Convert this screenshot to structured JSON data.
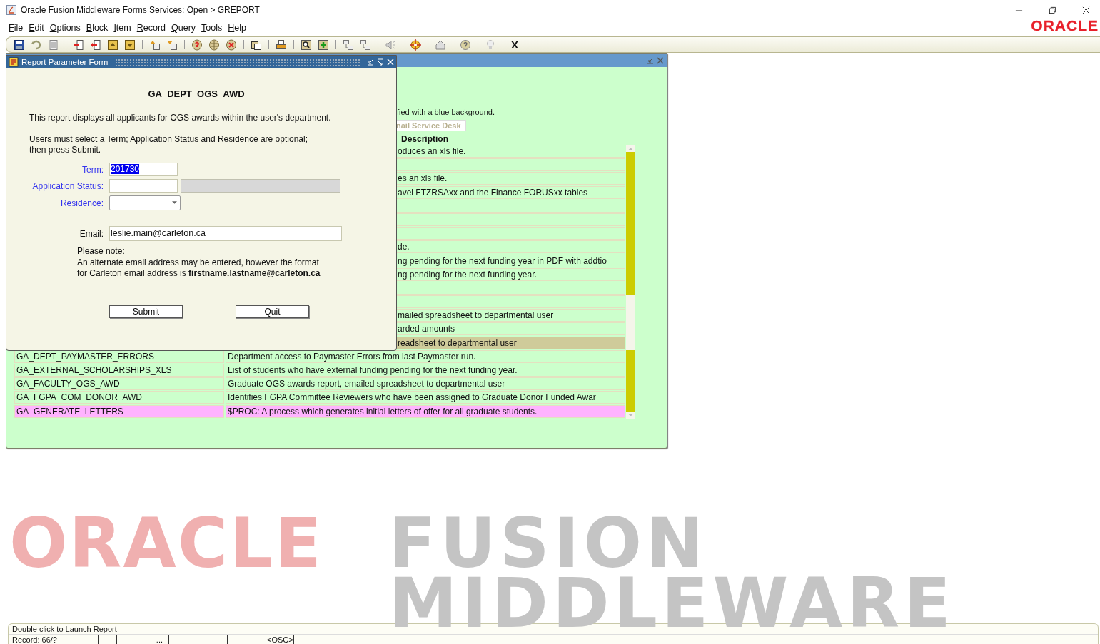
{
  "title_bar": {
    "title": "Oracle Fusion Middleware Forms Services:  Open > GREPORT"
  },
  "menu": [
    "File",
    "Edit",
    "Options",
    "Block",
    "Item",
    "Record",
    "Query",
    "Tools",
    "Help"
  ],
  "logo": "ORACLE",
  "toolbar": {
    "exit_label": "X"
  },
  "background_window": {
    "info_text": "fied with a blue background.",
    "service_desk_button": {
      "label": "nail Service Desk",
      "disabled": true
    },
    "description_header": "Description",
    "rows": [
      {
        "kind": "partial",
        "description": "oduces an xls file.",
        "selected": false,
        "hovered": false
      },
      {
        "kind": "partial",
        "selected": false,
        "hovered": false
      },
      {
        "kind": "partial",
        "description": "es an xls file.",
        "selected": false,
        "hovered": false
      },
      {
        "kind": "partial",
        "description": "avel FTZRSAxx and the Finance FORUSxx tables",
        "selected": false,
        "hovered": false
      },
      {
        "kind": "partial",
        "selected": false,
        "hovered": false
      },
      {
        "kind": "partial",
        "selected": false,
        "hovered": false
      },
      {
        "kind": "partial",
        "selected": false,
        "hovered": false
      },
      {
        "kind": "partial",
        "description": "de.",
        "selected": false,
        "hovered": false
      },
      {
        "kind": "partial",
        "description": "ng pending for the next funding year in PDF with addtio",
        "selected": false,
        "hovered": false
      },
      {
        "kind": "partial",
        "description": "ng pending for the next funding year.",
        "selected": false,
        "hovered": false
      },
      {
        "kind": "partial",
        "selected": false,
        "hovered": false
      },
      {
        "kind": "partial",
        "selected": false,
        "hovered": false
      },
      {
        "kind": "partial",
        "description": "mailed spreadsheet to departmental user",
        "selected": false,
        "hovered": false
      },
      {
        "kind": "partial",
        "description": "arded amounts",
        "selected": false,
        "hovered": false
      },
      {
        "kind": "partial",
        "description": "readsheet to departmental user",
        "selected": false,
        "hovered": true
      },
      {
        "kind": "full",
        "name": "GA_DEPT_PAYMASTER_ERRORS",
        "description": "Department access to Paymaster Errors from last Paymaster run.",
        "selected": false,
        "hovered": false
      },
      {
        "kind": "full",
        "name": "GA_EXTERNAL_SCHOLARSHIPS_XLS",
        "description": "List of students who have external funding pending for the next funding year.",
        "selected": false,
        "hovered": false
      },
      {
        "kind": "full",
        "name": "GA_FACULTY_OGS_AWD",
        "description": "Graduate OGS awards report, emailed spreadsheet to departmental user",
        "selected": false,
        "hovered": false
      },
      {
        "kind": "full",
        "name": "GA_FGPA_COM_DONOR_AWD",
        "description": "Identifies FGPA Committee Reviewers who have been assigned to Graduate Donor Funded Awar",
        "selected": false,
        "hovered": false
      },
      {
        "kind": "full",
        "name": "GA_GENERATE_LETTERS",
        "description": "$PROC: A process which generates  initial letters of offer for all graduate students.",
        "selected": true,
        "hovered": false
      }
    ]
  },
  "dialog": {
    "title": "Report Parameter Form",
    "heading": "GA_DEPT_OGS_AWD",
    "intro": "This report displays all applicants for OGS awards within the user's department.",
    "instructions": "Users must select a Term; Application Status and Residence are optional;\nthen press Submit.",
    "fields": [
      {
        "kind": "text",
        "label": "Term:",
        "value": "201730",
        "accent": true,
        "focused": true
      },
      {
        "kind": "lookup",
        "label": "Application Status:",
        "accent": true,
        "focused": false
      },
      {
        "kind": "dropdown",
        "label": "Residence:",
        "accent": true,
        "focused": false
      },
      {
        "kind": "wide",
        "label": "Email:",
        "value": "leslie.main@carleton.ca",
        "accent": false,
        "focused": false
      }
    ],
    "note_title": "Please note:",
    "note": "An alternate email address may be entered, however the format\nfor Carleton email address is **firstname.lastname@carleton.ca**",
    "buttons": [
      "Submit",
      "Quit"
    ]
  },
  "brand_banner": [
    "ORACLE",
    "FUSION",
    "MIDDLEWARE"
  ],
  "status_bar": {
    "message": "Double click to Launch Report",
    "record": "Record: 66/?",
    "segment_3": "...",
    "mode": "<OSC>"
  }
}
